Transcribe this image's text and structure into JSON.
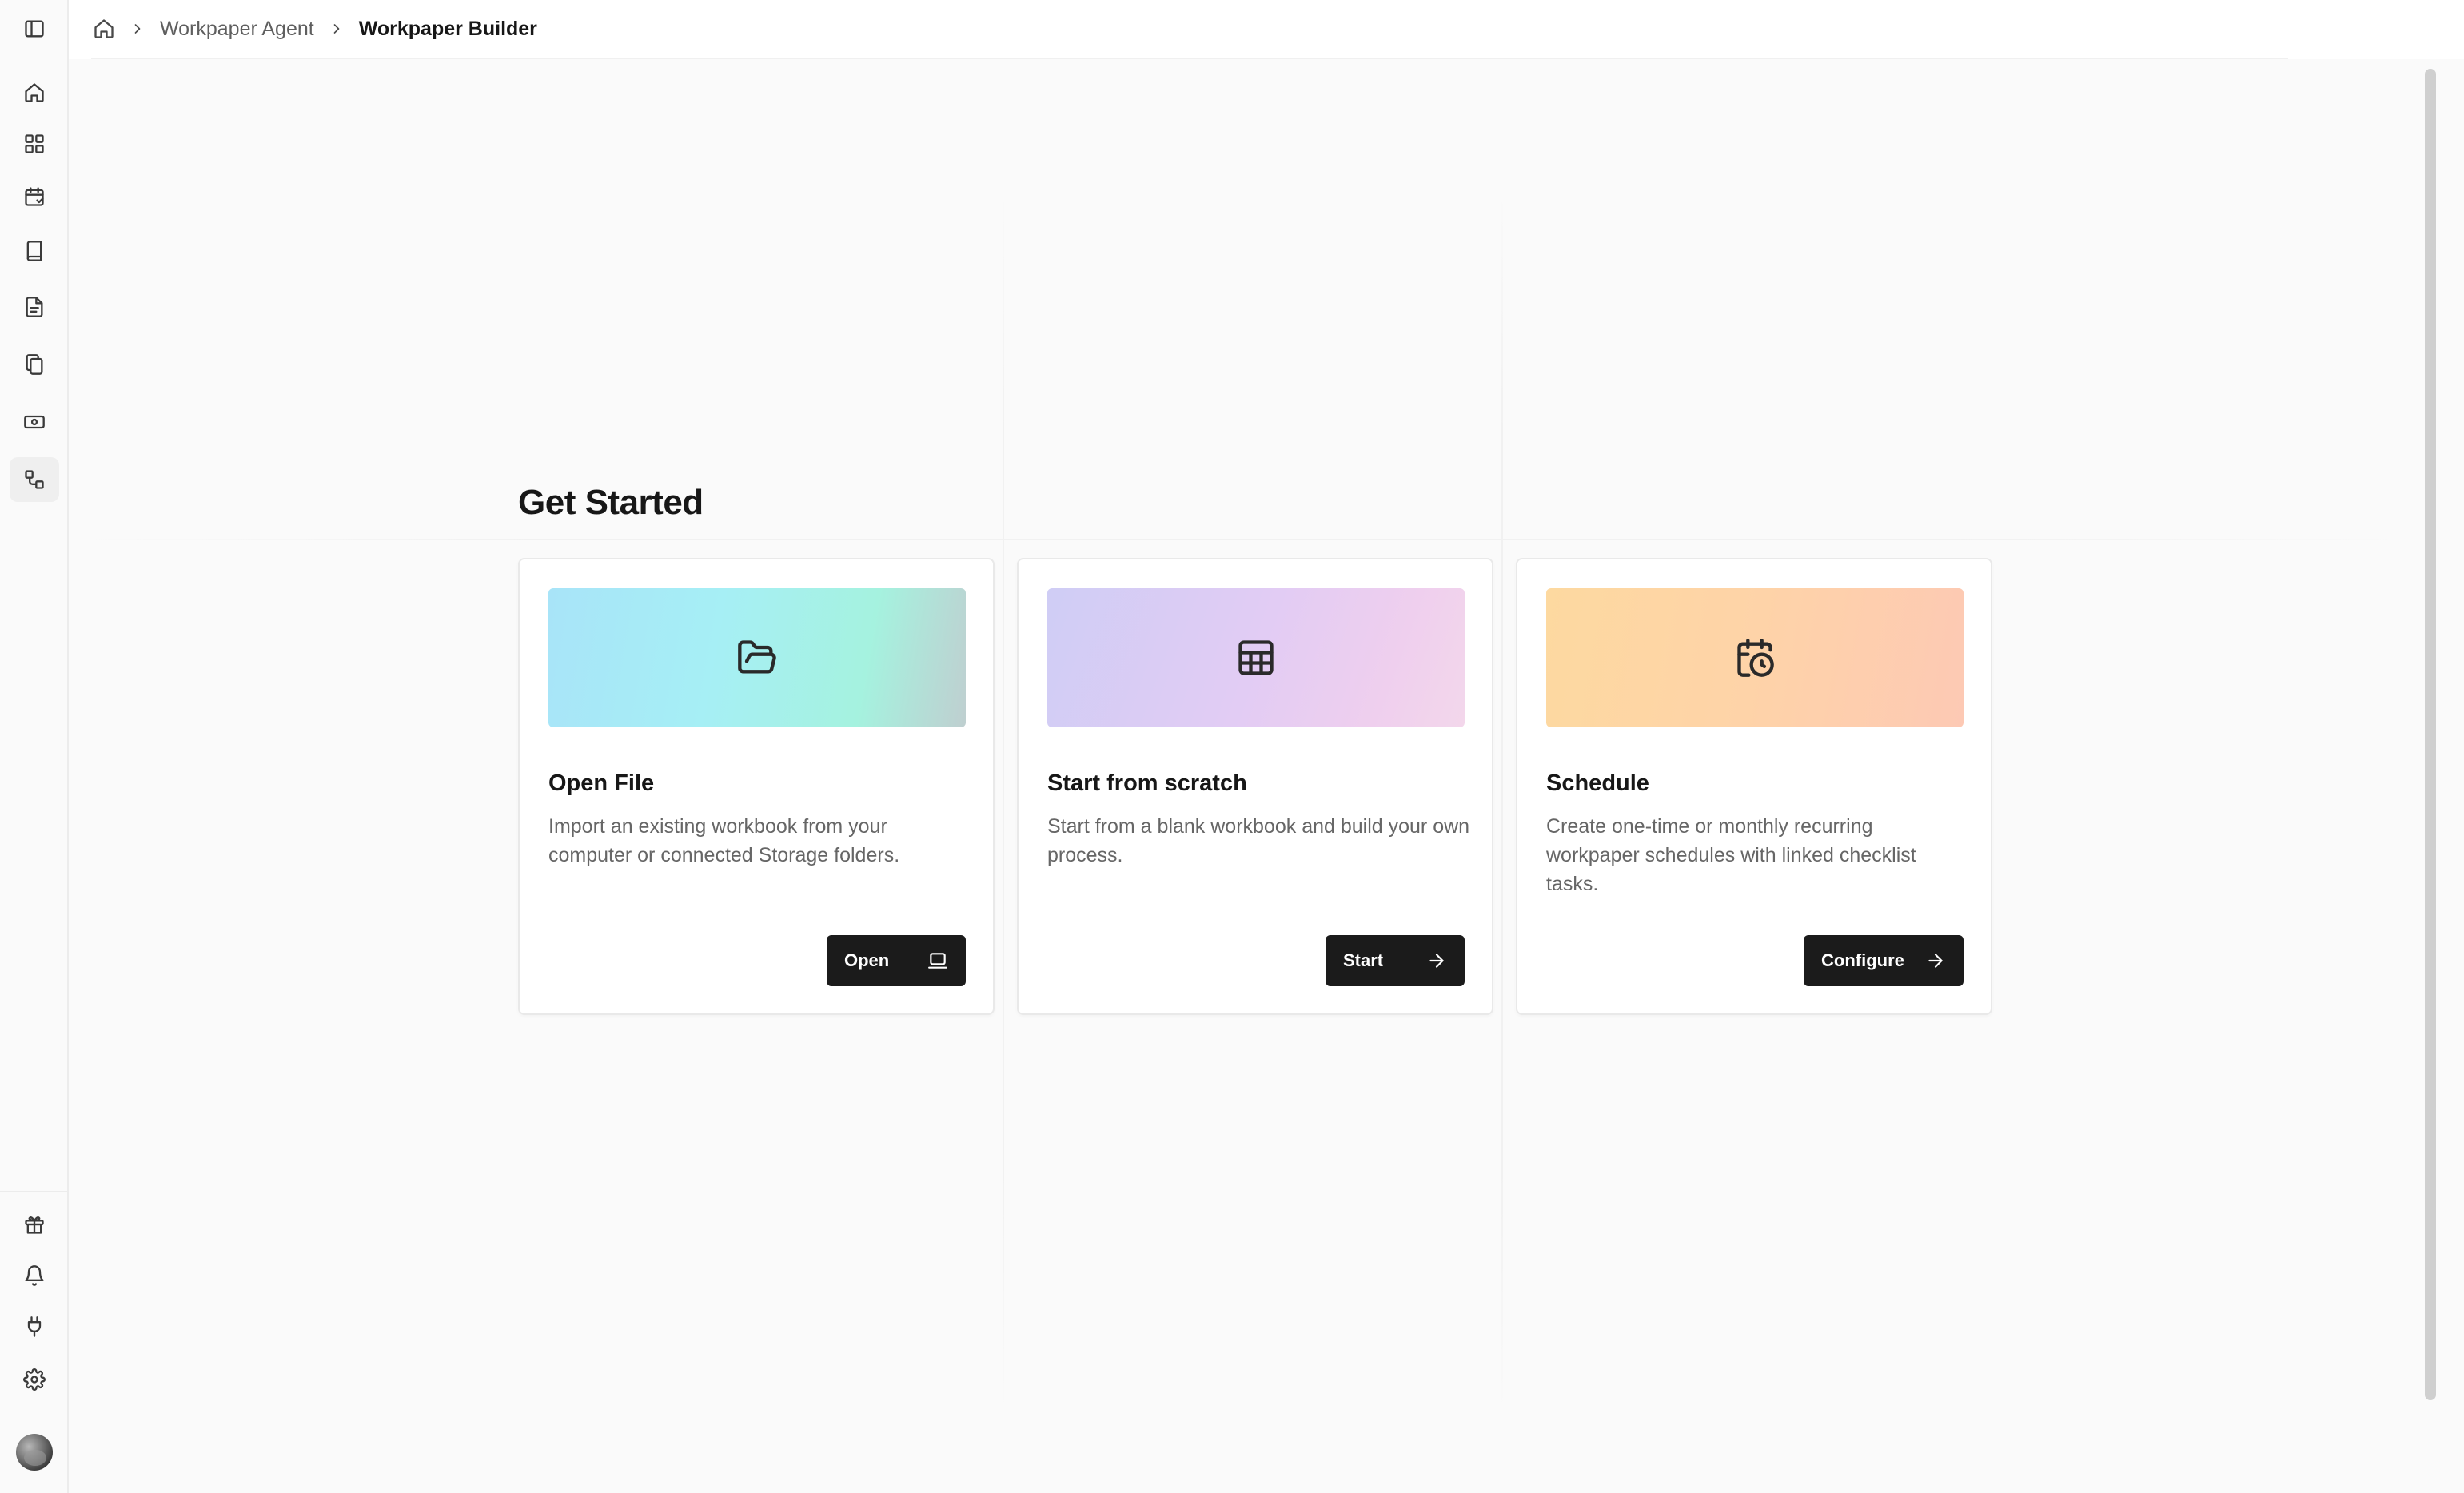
{
  "breadcrumb": {
    "home_icon": "home-icon",
    "items": [
      "Workpaper Agent",
      "Workpaper Builder"
    ]
  },
  "sidebar": {
    "top_icons": [
      "panel-left-icon"
    ],
    "nav_icons": [
      "home-icon",
      "dashboard-grid-icon",
      "calendar-check-icon",
      "book-icon",
      "document-icon",
      "files-copy-icon",
      "banknote-icon",
      "workflow-icon"
    ],
    "active_item": "workflow-icon",
    "bottom_icons": [
      "gift-icon",
      "bell-icon",
      "plug-icon",
      "settings-gear-icon"
    ],
    "avatar": "user-avatar"
  },
  "page": {
    "title": "Get Started"
  },
  "cards": [
    {
      "icon": "folder-open-icon",
      "title": "Open File",
      "description": "Import an existing workbook from your computer or connected Storage folders.",
      "button_label": "Open",
      "button_icon": "laptop-icon"
    },
    {
      "icon": "table-grid-icon",
      "title": "Start from scratch",
      "description": "Start from a blank workbook and build your own process.",
      "button_label": "Start",
      "button_icon": "arrow-right-icon"
    },
    {
      "icon": "calendar-clock-icon",
      "title": "Schedule",
      "description": "Create one-time or monthly recurring workpaper schedules with linked checklist tasks.",
      "button_label": "Configure",
      "button_icon": "arrow-right-icon"
    }
  ],
  "colors": {
    "button_bg": "#1b1b1b",
    "card_border": "#e9e9e9",
    "page_bg": "#fafafa"
  }
}
